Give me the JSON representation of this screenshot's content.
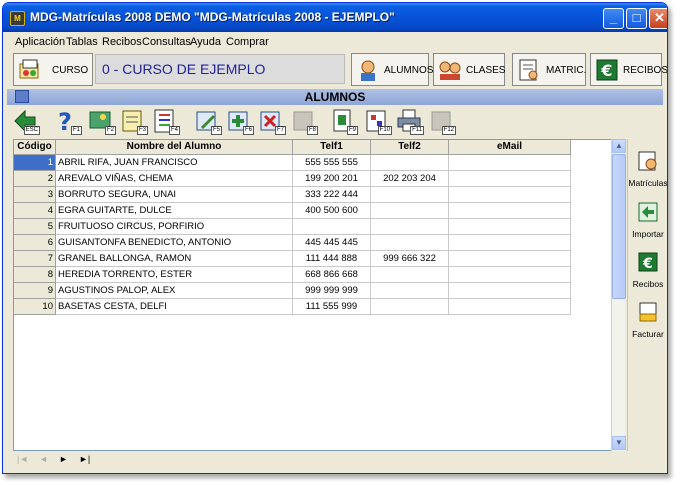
{
  "window": {
    "title": "MDG-Matrículas 2008 DEMO \"MDG-Matrículas 2008 - EJEMPLO\"",
    "app_icon_text": "M"
  },
  "titlebar_buttons": {
    "minimize": "_",
    "maximize": "□",
    "close": "✕"
  },
  "menu": [
    "Aplicación",
    "Tablas",
    "Recibos",
    "Consultas",
    "Ayuda",
    "Comprar"
  ],
  "toolbar": {
    "curso_label": "CURSO",
    "curso_value": "0 - CURSO DE EJEMPLO",
    "alumnos_label": "ALUMNOS",
    "clases_label": "CLASES",
    "matric_label": "MATRIC.",
    "recibos_label": "RECIBOS"
  },
  "section": {
    "title": "ALUMNOS"
  },
  "action_keys": [
    "ESC",
    "F1",
    "F2",
    "F3",
    "F4",
    "F5",
    "F6",
    "F7",
    "F8",
    "F9",
    "F10",
    "F11",
    "F12"
  ],
  "grid": {
    "columns": [
      "Código",
      "Nombre del Alumno",
      "Telf1",
      "Telf2",
      "eMail"
    ],
    "rows": [
      {
        "code": "1",
        "name": "ABRIL RIFA, JUAN FRANCISCO",
        "telf1": "555 555 555",
        "telf2": "",
        "email": ""
      },
      {
        "code": "2",
        "name": "AREVALO VIÑAS, CHEMA",
        "telf1": "199 200 201",
        "telf2": "202 203 204",
        "email": ""
      },
      {
        "code": "3",
        "name": "BORRUTO SEGURA, UNAI",
        "telf1": "333 222 444",
        "telf2": "",
        "email": ""
      },
      {
        "code": "4",
        "name": "EGRA GUITARTE, DULCE",
        "telf1": "400 500 600",
        "telf2": "",
        "email": ""
      },
      {
        "code": "5",
        "name": "FRUITUOSO CIRCUS, PORFIRIO",
        "telf1": "",
        "telf2": "",
        "email": ""
      },
      {
        "code": "6",
        "name": "GUISANTONFA BENEDICTO, ANTONIO",
        "telf1": "445 445 445",
        "telf2": "",
        "email": ""
      },
      {
        "code": "7",
        "name": "GRANEL BALLONGA, RAMON",
        "telf1": "111 444 888",
        "telf2": "999 666 322",
        "email": ""
      },
      {
        "code": "8",
        "name": "HEREDIA TORRENTO, ESTER",
        "telf1": "668 866 668",
        "telf2": "",
        "email": ""
      },
      {
        "code": "9",
        "name": "AGUSTINOS PALOP, ALEX",
        "telf1": "999 999 999",
        "telf2": "",
        "email": ""
      },
      {
        "code": "10",
        "name": "BASETAS CESTA, DELFI",
        "telf1": "111 555 999",
        "telf2": "",
        "email": ""
      }
    ]
  },
  "sidepanel": [
    "Matrículas",
    "Importar",
    "Recibos",
    "Facturar"
  ],
  "navigator": {
    "first": "|◄",
    "prev": "◄",
    "next": "►",
    "last": "►|"
  },
  "colors": {
    "title_bar": "#0753d8",
    "active_row": "#3d6ec8",
    "section_bar": "#8ea6d6",
    "curso_text": "#22229a"
  }
}
